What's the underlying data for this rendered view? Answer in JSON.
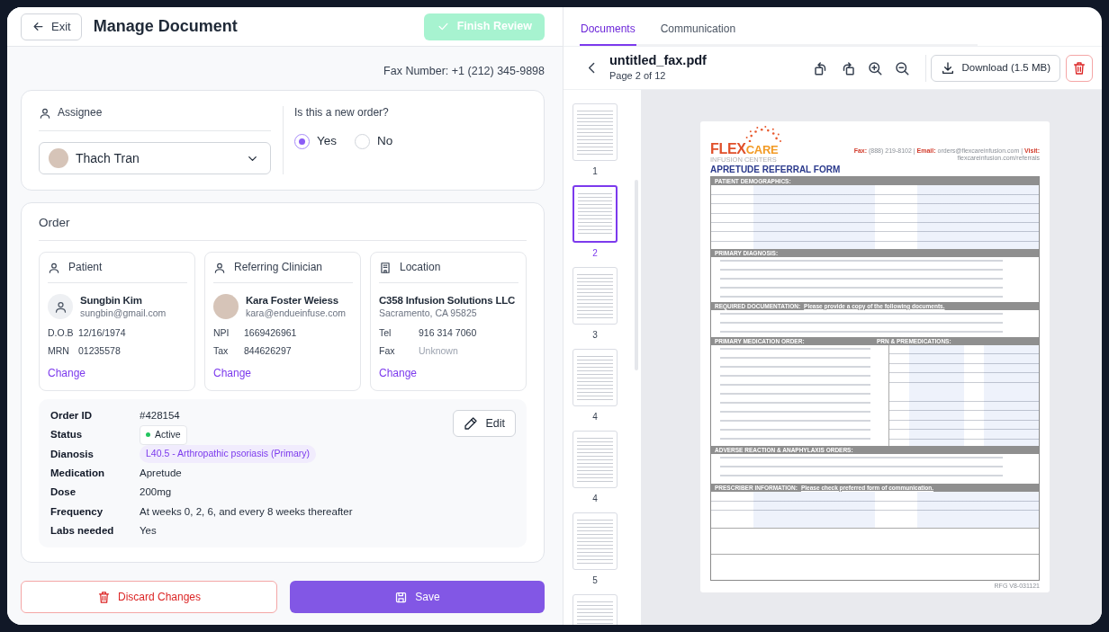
{
  "header": {
    "exit_label": "Exit",
    "title": "Manage Document",
    "finish_button": {
      "label": "Finish Review",
      "disabled": true
    }
  },
  "fax_number": "Fax Number: +1 (212) 345-9898",
  "assignee": {
    "label": "Assignee",
    "photo": true,
    "value": "Thach Tran"
  },
  "new_order": {
    "question": "Is this a new order?",
    "options": [
      {
        "label": "Yes",
        "selected": true
      },
      {
        "label": "No",
        "selected": false
      }
    ]
  },
  "order": {
    "title": "Order",
    "cards": [
      {
        "kind": "patient",
        "title": "Patient",
        "name": "Sungbin Kim",
        "sub": "sungbin@gmail.com",
        "fields": [
          {
            "label": "D.O.B",
            "value": "12/16/1974",
            "muted": false
          },
          {
            "label": "MRN",
            "value": "01235578",
            "muted": false
          }
        ],
        "action": "Change"
      },
      {
        "kind": "clinician",
        "title": "Referring Clinician",
        "name": "Kara Foster Weiess",
        "sub": "kara@endueinfuse.com",
        "fields": [
          {
            "label": "NPI",
            "value": "1669426961",
            "muted": false
          },
          {
            "label": "Tax",
            "value": "844626297",
            "muted": false
          }
        ],
        "action": "Change"
      },
      {
        "kind": "location",
        "title": "Location",
        "name": "C358 Infusion Solutions LLC",
        "sub": "Sacramento, CA 95825",
        "fields": [
          {
            "label": "Tel",
            "value": "916 314 7060",
            "muted": false
          },
          {
            "label": "Fax",
            "value": "Unknown",
            "muted": true
          }
        ],
        "action": "Change"
      }
    ],
    "details": [
      {
        "label": "Order ID",
        "value": "#428154",
        "kind": "text"
      },
      {
        "label": "Status",
        "value": "Active",
        "kind": "status"
      },
      {
        "label": "Dianosis",
        "value": "L40.5 - Arthropathic psoriasis (Primary)",
        "kind": "tag"
      },
      {
        "label": "Medication",
        "value": "Apretude",
        "kind": "text"
      },
      {
        "label": "Dose",
        "value": "200mg",
        "kind": "text"
      },
      {
        "label": "Frequency",
        "value": "At weeks 0, 2, 6, and every 8 weeks thereafter",
        "kind": "text"
      },
      {
        "label": "Labs needed",
        "value": "Yes",
        "kind": "text"
      }
    ],
    "edit_label": "Edit"
  },
  "actions": {
    "discard": "Discard Changes",
    "save": "Save"
  },
  "tabs": [
    {
      "label": "Documents",
      "selected": true
    },
    {
      "label": "Communication",
      "selected": false
    }
  ],
  "file": {
    "name": "untitled_fax.pdf",
    "page": "Page 2 of 12",
    "download": "Download (1.5 MB)"
  },
  "thumbnails": [
    {
      "label": "1",
      "selected": false
    },
    {
      "label": "2",
      "selected": true
    },
    {
      "label": "3",
      "selected": false
    },
    {
      "label": "4",
      "selected": false
    },
    {
      "label": "4",
      "selected": false
    },
    {
      "label": "5",
      "selected": false
    },
    {
      "selected": false
    }
  ],
  "fax_page": {
    "brand_main": "FLEX",
    "brand_accent": "CARE",
    "brand_sub": "INFUSION CENTERS",
    "contact": "**Fax:** (888) 219-8102 | **Email:** orders@flexcareinfusion.com | **Visit:** flexcareinfusion.com/referrals",
    "form_title": "APRETUDE REFERRAL FORM",
    "sections": [
      {
        "kind": "fields",
        "heading": "PATIENT DEMOGRAPHICS:"
      },
      {
        "kind": "checklist",
        "heading": "PRIMARY DIAGNOSIS:"
      },
      {
        "kind": "checklist",
        "heading": "REQUIRED DOCUMENTATION:",
        "note": "Please provide a copy of the following documents."
      },
      {
        "kind": "split",
        "headings": [
          "PRIMARY MEDICATION ORDER:",
          "PRN & PREMEDICATIONS:"
        ]
      },
      {
        "kind": "checklist",
        "heading": "ADVERSE REACTION & ANAPHYLAXIS ORDERS:"
      },
      {
        "kind": "fields",
        "heading": "PRESCRIBER INFORMATION:",
        "note": "Please check preferred form of communication."
      }
    ],
    "footer": "RFG V8-031121"
  }
}
